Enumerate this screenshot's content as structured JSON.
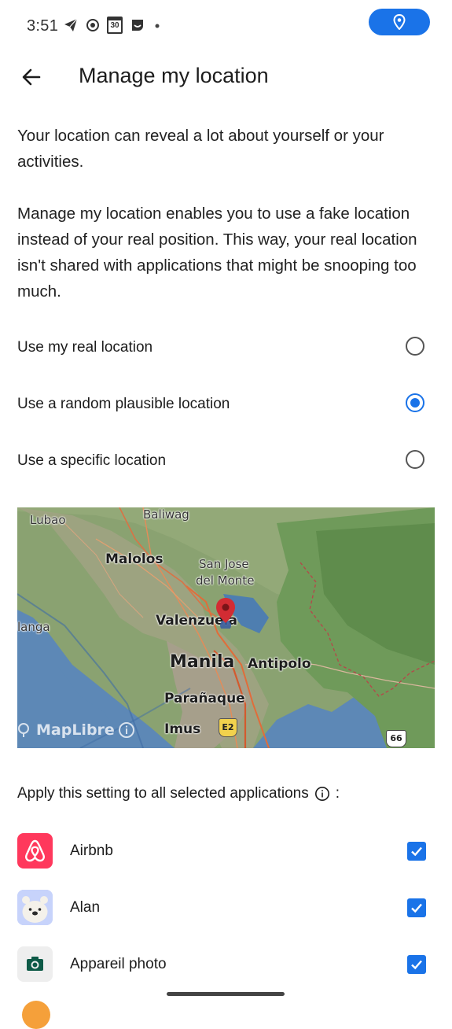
{
  "status_bar": {
    "time": "3:51",
    "calendar_day": "30",
    "icons": [
      "telegram-icon",
      "record-icon",
      "calendar-icon",
      "sticker-icon",
      "dot-icon"
    ],
    "location_pill_color": "#1a73e8"
  },
  "header": {
    "title": "Manage my location"
  },
  "intro": {
    "paragraph1": "Your location can reveal a lot about yourself or your activities.",
    "paragraph2": "Manage my location enables you to use a fake location instead of your real position. This way, your real location isn't shared with applications that might be snooping too much."
  },
  "options": [
    {
      "label": "Use my real location",
      "selected": false
    },
    {
      "label": "Use a random plausible location",
      "selected": true
    },
    {
      "label": "Use a specific location",
      "selected": false
    }
  ],
  "map": {
    "labels": [
      "Lubao",
      "Baliwag",
      "Malolos",
      "San Jose",
      "del Monte",
      "langa",
      "Valenzuela",
      "Manila",
      "Antipolo",
      "Parañaque",
      "Imus",
      "E2",
      "66"
    ],
    "attribution": "MapLibre"
  },
  "apply": {
    "label": "Apply this setting to all selected applications",
    "suffix": ":"
  },
  "apps": [
    {
      "name": "Airbnb",
      "checked": true,
      "icon": "airbnb-icon"
    },
    {
      "name": "Alan",
      "checked": true,
      "icon": "alan-icon"
    },
    {
      "name": "Appareil photo",
      "checked": true,
      "icon": "camera-icon"
    }
  ],
  "colors": {
    "accent": "#1a73e8",
    "airbnb": "#ff385c"
  }
}
